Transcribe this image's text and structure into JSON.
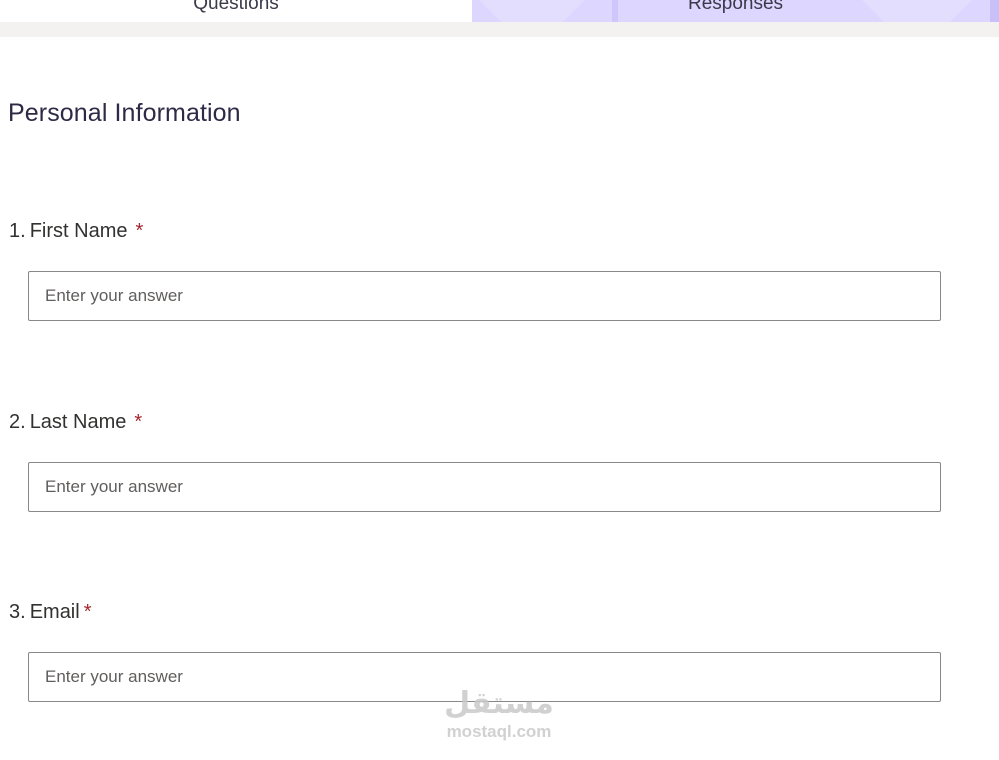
{
  "tabs": {
    "questions_label": "Questions",
    "responses_label": "Responses"
  },
  "section": {
    "title": "Personal Information"
  },
  "questions": [
    {
      "number": "1.",
      "label": "First Name",
      "required_mark": "*",
      "placeholder": "Enter your answer",
      "value": ""
    },
    {
      "number": "2.",
      "label": "Last Name",
      "required_mark": "*",
      "placeholder": "Enter your answer",
      "value": ""
    },
    {
      "number": "3.",
      "label": "Email",
      "required_mark": "*",
      "placeholder": "Enter your answer",
      "value": ""
    }
  ],
  "watermark": {
    "arabic": "مستقل",
    "latin": "mostaql.com"
  },
  "colors": {
    "accent_tab": "#ddd6ff",
    "required": "#a4262c",
    "title": "#2d2a45",
    "input_border": "#8a8886"
  }
}
